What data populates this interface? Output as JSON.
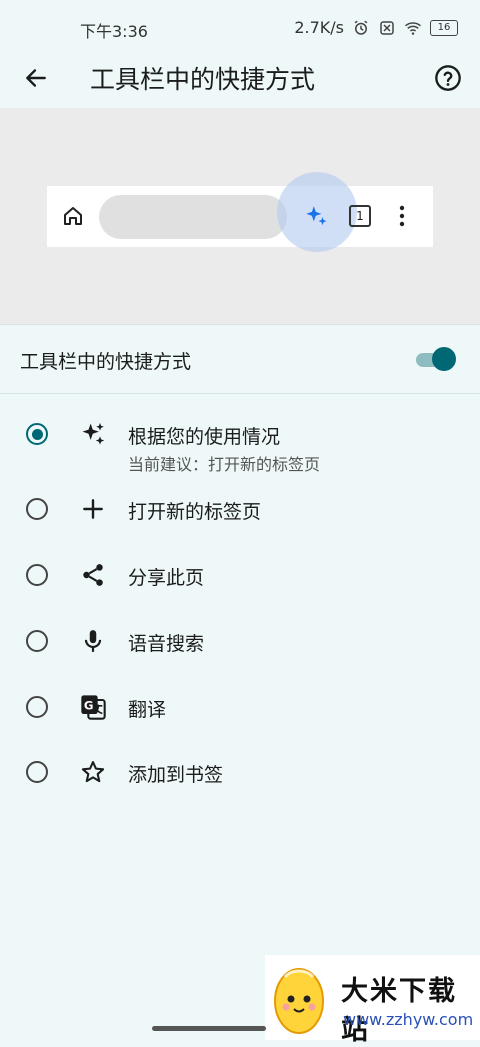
{
  "status_bar": {
    "time": "下午3:36",
    "net_speed": "2.7K/s",
    "battery": "16",
    "icons": [
      "alarm-icon",
      "no-sim-icon",
      "wifi-icon",
      "battery-icon"
    ]
  },
  "app_bar": {
    "title": "工具栏中的快捷方式",
    "back_icon": "arrow-back-icon",
    "help_icon": "help-circle-icon"
  },
  "preview": {
    "tab_count": "1",
    "icons": [
      "home-icon",
      "sparkle-icon",
      "tab-switcher-icon",
      "more-vert-icon"
    ]
  },
  "toggle": {
    "label": "工具栏中的快捷方式",
    "enabled": true
  },
  "options": [
    {
      "label": "根据您的使用情况",
      "sublabel": "当前建议：打开新的标签页",
      "icon": "sparkle-icon",
      "selected": true
    },
    {
      "label": "打开新的标签页",
      "icon": "plus-icon",
      "selected": false
    },
    {
      "label": "分享此页",
      "icon": "share-icon",
      "selected": false
    },
    {
      "label": "语音搜索",
      "icon": "mic-icon",
      "selected": false
    },
    {
      "label": "翻译",
      "icon": "translate-icon",
      "selected": false
    },
    {
      "label": "添加到书签",
      "icon": "star-outline-icon",
      "selected": false
    }
  ],
  "watermark": {
    "title": "大米下载站",
    "url": "www.zzhyw.com"
  },
  "colors": {
    "background": "#eef8f8",
    "accent": "#006874",
    "preview_bg": "#ebebeb",
    "sparkle": "#1a73e8"
  }
}
